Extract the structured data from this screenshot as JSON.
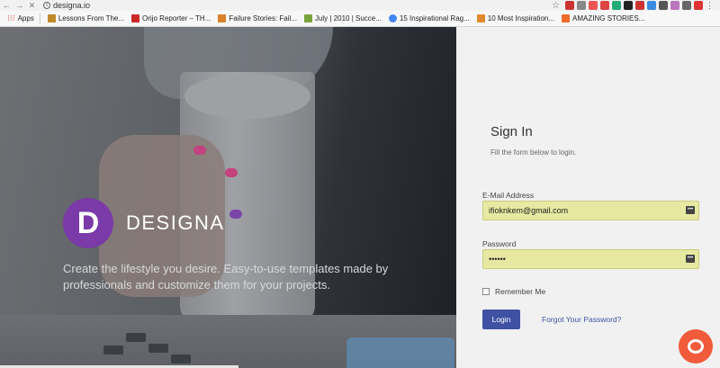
{
  "browser": {
    "url": "designa.io",
    "bookmarks": [
      {
        "label": "Apps",
        "color": "#e44"
      },
      {
        "label": "Lessons From The...",
        "color": "#c08a2b"
      },
      {
        "label": "Orijo Reporter – TH...",
        "color": "#cc2a2a"
      },
      {
        "label": "Failure Stories: Fail...",
        "color": "#d9822b"
      },
      {
        "label": "July | 2010 | Succe...",
        "color": "#7aa33d"
      },
      {
        "label": "15 Inspirational Rag...",
        "color": "#4285f4"
      },
      {
        "label": "10 Most Inspiration...",
        "color": "#e08a2e"
      },
      {
        "label": "AMAZING STORIES...",
        "color": "#f06a2a"
      }
    ]
  },
  "hero": {
    "logo_letter": "D",
    "brand_name": "DESIGNA",
    "tagline": "Create the lifestyle you desire. Easy-to-use templates made by professionals and customize them for your projects."
  },
  "signin": {
    "title": "Sign In",
    "subtitle": "Fill the form below to login.",
    "email_label": "E-Mail Address",
    "email_value": "ifioknkem@gmail.com",
    "password_label": "Password",
    "password_value": "••••••",
    "remember_label": "Remember Me",
    "login_label": "Login",
    "forgot_label": "Forgot Your Password?"
  },
  "colors": {
    "accent": "#3f51a3",
    "brand": "#7a3aa8",
    "chat": "#f15a3b",
    "autofill": "#e7e9a2"
  }
}
